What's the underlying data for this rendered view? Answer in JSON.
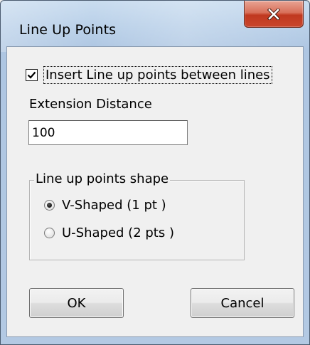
{
  "window": {
    "title": "Line Up Points"
  },
  "titlebar": {
    "close_icon": "close-x-icon",
    "close_color": "#c7402a"
  },
  "insert_checkbox": {
    "label": "Insert Line up points between lines",
    "checked": true
  },
  "extension": {
    "label": "Extension Distance",
    "value": "100"
  },
  "shape_group": {
    "legend": "Line up points shape",
    "options": [
      {
        "label": "V-Shaped (1 pt )",
        "selected": true
      },
      {
        "label": "U-Shaped (2 pts )",
        "selected": false
      }
    ]
  },
  "buttons": {
    "ok_label": "OK",
    "cancel_label": "Cancel"
  }
}
